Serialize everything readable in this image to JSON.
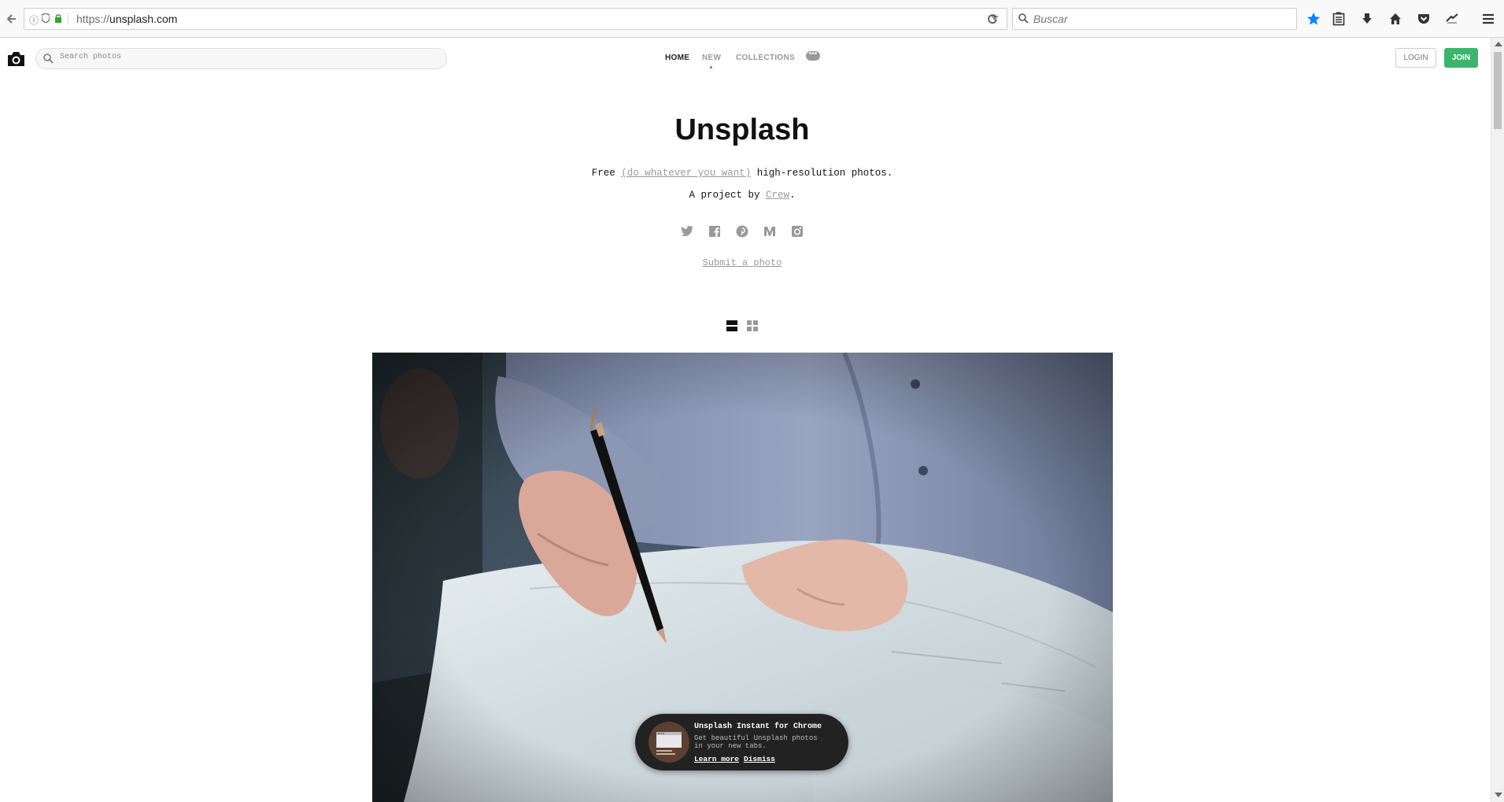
{
  "browser": {
    "url_protocol": "https://",
    "url_host": "unsplash.com",
    "search_placeholder": "Buscar"
  },
  "nav": {
    "search_placeholder": "Search photos",
    "links": [
      "HOME",
      "NEW",
      "COLLECTIONS"
    ],
    "more": "•••",
    "login": "LOGIN",
    "join": "JOIN"
  },
  "hero": {
    "title": "Unsplash",
    "tagline_before": "Free ",
    "tagline_link": "(do whatever you want)",
    "tagline_after": " high-resolution photos.",
    "byline_before": "A project by ",
    "byline_link": "Crew",
    "byline_after": ".",
    "social_icons": [
      "twitter-icon",
      "facebook-icon",
      "pinterest-icon",
      "medium-icon",
      "instagram-icon"
    ],
    "submit": "Submit a photo"
  },
  "promo": {
    "title": "Unsplash Instant for Chrome",
    "desc": "Get beautiful Unsplash photos in your new tabs.",
    "learn_more": "Learn more",
    "dismiss": "Dismiss"
  },
  "colors": {
    "join_green": "#3cb46e",
    "active_dot": "#e64a4a",
    "bookmark_star": "#0a84ff"
  }
}
